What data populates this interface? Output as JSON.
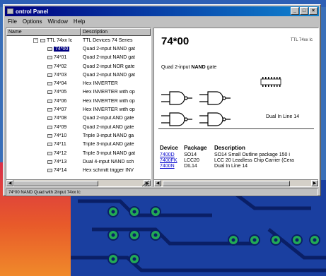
{
  "window": {
    "title": "ontrol Panel",
    "buttons": [
      "_",
      "□",
      "×"
    ]
  },
  "menu": [
    "File",
    "Options",
    "Window",
    "Help"
  ],
  "left_pane": {
    "columns": [
      "Name",
      "Description"
    ],
    "root": {
      "name": "TTL 74xx Ic",
      "description": "TTL Devices 74 Series"
    },
    "rows": [
      {
        "name": "74*00",
        "description": "Quad 2-input NAND gat",
        "selected": true
      },
      {
        "name": "74*01",
        "description": "Quad 2-input NAND gat"
      },
      {
        "name": "74*02",
        "description": "Quad 2-input NOR gate"
      },
      {
        "name": "74*03",
        "description": "Quad 2-input NAND gat"
      },
      {
        "name": "74*04",
        "description": "Hex INVERTER"
      },
      {
        "name": "74*05",
        "description": "Hex INVERTER with op"
      },
      {
        "name": "74*06",
        "description": "Hex INVERTER with op"
      },
      {
        "name": "74*07",
        "description": "Hex INVERTER with op"
      },
      {
        "name": "74*08",
        "description": "Quad 2-input AND gate"
      },
      {
        "name": "74*09",
        "description": "Quad 2-input AND gate"
      },
      {
        "name": "74*10",
        "description": "Triple 3-input NAND ga"
      },
      {
        "name": "74*11",
        "description": "Triple 3-input AND gate"
      },
      {
        "name": "74*12",
        "description": "Triple 3-input NAND gat"
      },
      {
        "name": "74*13",
        "description": "Dual 4-input NAND sch"
      },
      {
        "name": "74*14",
        "description": "Hex schmitt trigger INV"
      }
    ]
  },
  "right_pane": {
    "part": "74*00",
    "family": "TTL 74xx Ic",
    "description_prefix": "Quad 2-input ",
    "description_bold": "NAND",
    "description_suffix": " gate",
    "package_label": "Dual In Line 14",
    "table": {
      "headers": [
        "Device",
        "Package",
        "Description"
      ],
      "rows": [
        [
          "7400D",
          "SO14",
          "SO14 Small Outline package 150 i"
        ],
        [
          "7400FK",
          "LCC20",
          "LCC 20 Leadless Chip Carrier (Cera"
        ],
        [
          "7400N",
          "DIL14",
          "Dual In Line 14"
        ]
      ]
    }
  },
  "status_text": "74*00 NAND Quad with 2input 74xx Ic",
  "colors": {
    "titlebar": "#000080",
    "selection": "#000080",
    "link": "#0000cc",
    "pcb": "#1a3fa0",
    "pad": "#22aa55"
  }
}
